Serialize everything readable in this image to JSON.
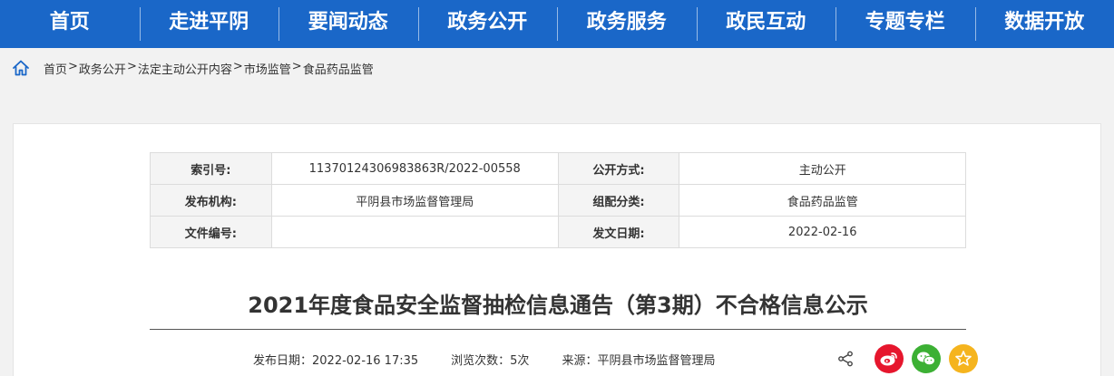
{
  "nav": {
    "items": [
      "首页",
      "走进平阴",
      "要闻动态",
      "政务公开",
      "政务服务",
      "政民互动",
      "专题专栏",
      "数据开放"
    ]
  },
  "breadcrumb": {
    "items": [
      "首页",
      "政务公开",
      "法定主动公开内容",
      "市场监管",
      "食品药品监管"
    ],
    "separator": ">"
  },
  "meta": {
    "index_label": "索引号:",
    "index_value": "11370124306983863R/2022-00558",
    "open_mode_label": "公开方式:",
    "open_mode_value": "主动公开",
    "publisher_label": "发布机构:",
    "publisher_value": "平阴县市场监督管理局",
    "category_label": "组配分类:",
    "category_value": "食品药品监管",
    "doc_no_label": "文件编号:",
    "doc_no_value": "",
    "issue_date_label": "发文日期:",
    "issue_date_value": "2022-02-16"
  },
  "article": {
    "title": "2021年度食品安全监督抽检信息通告（第3期）不合格信息公示",
    "publish_date": "发布日期：2022-02-16 17:35",
    "views": "浏览次数：5次",
    "source": "来源：平阴县市场监督管理局"
  },
  "colors": {
    "nav_bg": "#1a67c8",
    "weibo": "#e6162d",
    "wechat": "#3cb034",
    "favorite": "#f5b41e"
  },
  "icons": {
    "home": "home-icon",
    "share": "share-icon",
    "weibo": "weibo-icon",
    "wechat": "wechat-icon",
    "favorite": "star-icon"
  }
}
